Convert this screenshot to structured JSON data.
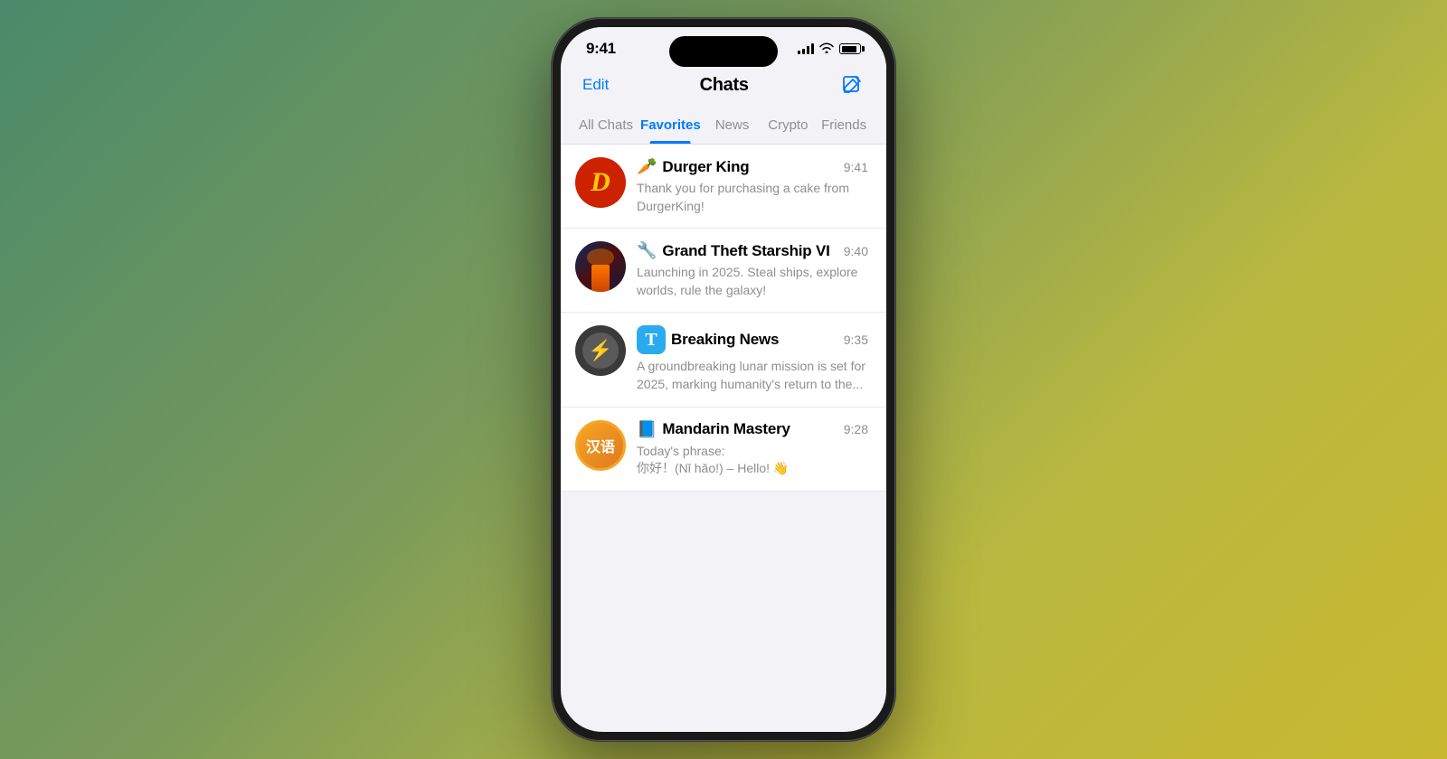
{
  "background": {
    "gradient": "linear-gradient(135deg, #4a8a6a, #7a9a5a, #b8b840, #c8b830)"
  },
  "phone": {
    "status_bar": {
      "time": "9:41",
      "signal_level": 4,
      "wifi": true,
      "battery_percent": 85
    },
    "nav": {
      "edit_label": "Edit",
      "title": "Chats",
      "compose_icon": "compose-icon"
    },
    "tabs": [
      {
        "id": "all-chats",
        "label": "All Chats",
        "active": false
      },
      {
        "id": "favorites",
        "label": "Favorites",
        "active": true
      },
      {
        "id": "news",
        "label": "News",
        "active": false
      },
      {
        "id": "crypto",
        "label": "Crypto",
        "active": false
      },
      {
        "id": "friends",
        "label": "Friends",
        "active": false
      }
    ],
    "chats": [
      {
        "id": "durger-king",
        "name": "Durger King",
        "time": "9:41",
        "preview": "Thank you for purchasing a cake from DurgerKing!",
        "avatar_type": "dk",
        "avatar_letter": "D",
        "bot_icon": "🥕"
      },
      {
        "id": "grand-theft-starship",
        "name": "Grand Theft Starship VI",
        "time": "9:40",
        "preview": "Launching in 2025. Steal ships, explore worlds, rule the galaxy!",
        "avatar_type": "gts",
        "bot_icon": "🔧"
      },
      {
        "id": "breaking-news",
        "name": "Breaking News",
        "time": "9:35",
        "preview": "A groundbreaking lunar mission is set for 2025, marking humanity's return to the...",
        "avatar_type": "bn",
        "bot_icon": "T"
      },
      {
        "id": "mandarin-mastery",
        "name": "Mandarin Mastery",
        "time": "9:28",
        "preview": "Today's phrase:\n你好！(Nǐ hǎo!) – Hello! 👋",
        "avatar_type": "mm",
        "bot_icon": "📘"
      }
    ]
  }
}
